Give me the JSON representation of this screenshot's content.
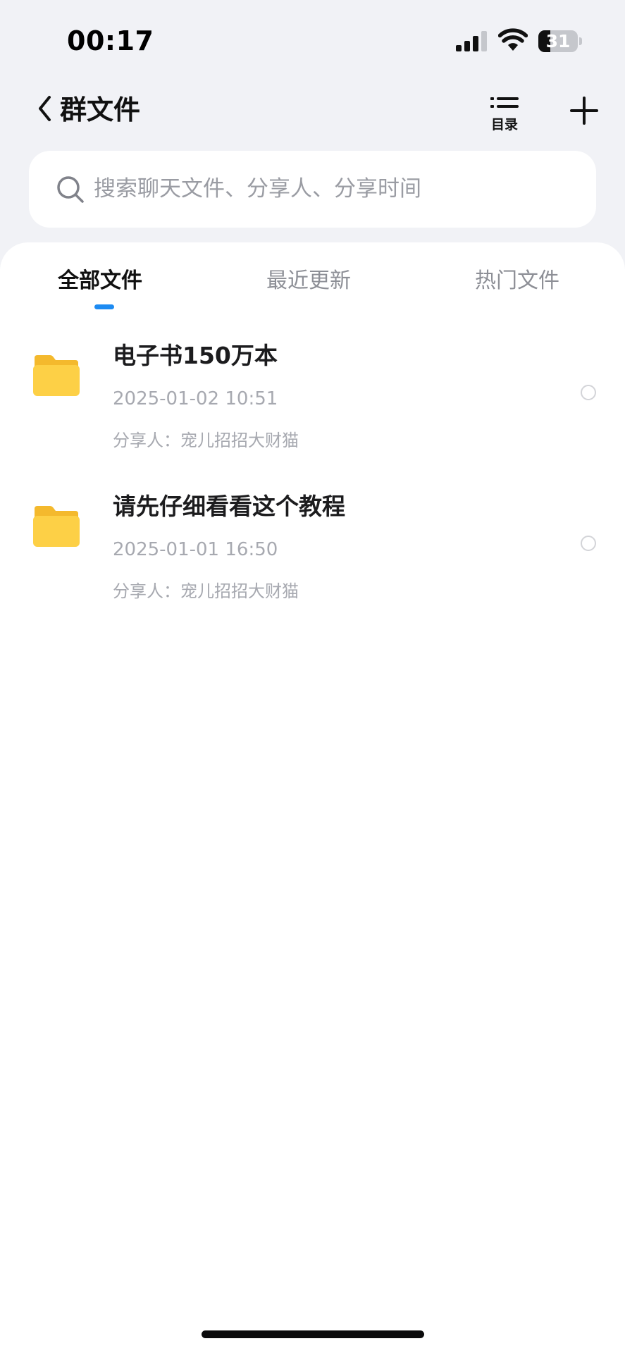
{
  "status_bar": {
    "time": "00:17",
    "battery": "31",
    "battery_level": 0.31
  },
  "nav": {
    "title": "群文件",
    "directory_label": "目录"
  },
  "search": {
    "placeholder": "搜索聊天文件、分享人、分享时间"
  },
  "tabs": [
    {
      "label": "全部文件",
      "active": true
    },
    {
      "label": "最近更新",
      "active": false
    },
    {
      "label": "热门文件",
      "active": false
    }
  ],
  "files": [
    {
      "name": "电子书150万本",
      "time": "2025-01-02 10:51",
      "sharer": "分享人：宠儿招招大财猫",
      "icon": "folder-icon"
    },
    {
      "name": "请先仔细看看这个教程",
      "time": "2025-01-01 16:50",
      "sharer": "分享人：宠儿招招大财猫",
      "icon": "folder-icon"
    }
  ],
  "colors": {
    "accent": "#1d8bf2",
    "folder": "#fccb3d",
    "background": "#f1f2f6"
  }
}
